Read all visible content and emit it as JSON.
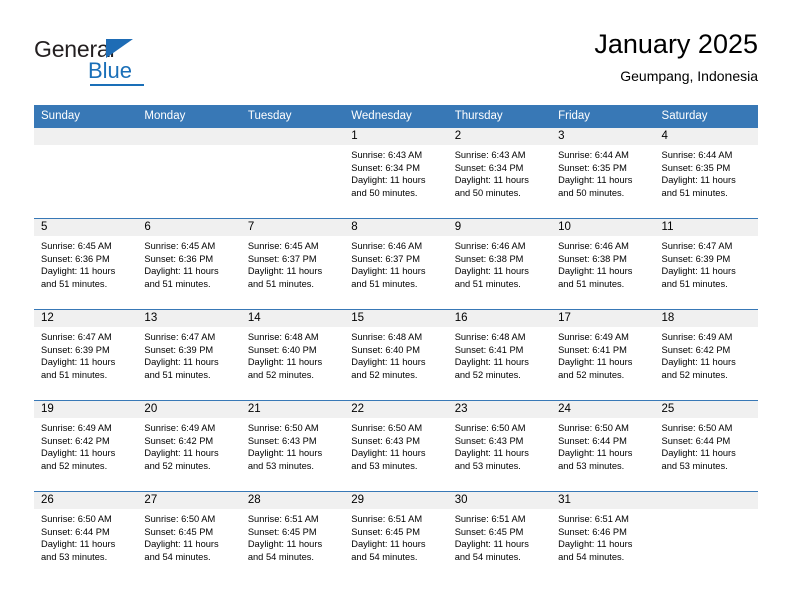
{
  "brand": {
    "name_top": "General",
    "name_bottom": "Blue",
    "accent_color": "#1a6fb8"
  },
  "header": {
    "title": "January 2025",
    "subtitle": "Geumpang, Indonesia"
  },
  "theme": {
    "header_bg": "#3878b6",
    "daynum_bg": "#f0f0f0",
    "text_color": "#000000"
  },
  "weekday_headers": [
    "Sunday",
    "Monday",
    "Tuesday",
    "Wednesday",
    "Thursday",
    "Friday",
    "Saturday"
  ],
  "weeks": [
    [
      {
        "day": "",
        "sunrise": "",
        "sunset": "",
        "daylight1": "",
        "daylight2": ""
      },
      {
        "day": "",
        "sunrise": "",
        "sunset": "",
        "daylight1": "",
        "daylight2": ""
      },
      {
        "day": "",
        "sunrise": "",
        "sunset": "",
        "daylight1": "",
        "daylight2": ""
      },
      {
        "day": "1",
        "sunrise": "Sunrise: 6:43 AM",
        "sunset": "Sunset: 6:34 PM",
        "daylight1": "Daylight: 11 hours",
        "daylight2": "and 50 minutes."
      },
      {
        "day": "2",
        "sunrise": "Sunrise: 6:43 AM",
        "sunset": "Sunset: 6:34 PM",
        "daylight1": "Daylight: 11 hours",
        "daylight2": "and 50 minutes."
      },
      {
        "day": "3",
        "sunrise": "Sunrise: 6:44 AM",
        "sunset": "Sunset: 6:35 PM",
        "daylight1": "Daylight: 11 hours",
        "daylight2": "and 50 minutes."
      },
      {
        "day": "4",
        "sunrise": "Sunrise: 6:44 AM",
        "sunset": "Sunset: 6:35 PM",
        "daylight1": "Daylight: 11 hours",
        "daylight2": "and 51 minutes."
      }
    ],
    [
      {
        "day": "5",
        "sunrise": "Sunrise: 6:45 AM",
        "sunset": "Sunset: 6:36 PM",
        "daylight1": "Daylight: 11 hours",
        "daylight2": "and 51 minutes."
      },
      {
        "day": "6",
        "sunrise": "Sunrise: 6:45 AM",
        "sunset": "Sunset: 6:36 PM",
        "daylight1": "Daylight: 11 hours",
        "daylight2": "and 51 minutes."
      },
      {
        "day": "7",
        "sunrise": "Sunrise: 6:45 AM",
        "sunset": "Sunset: 6:37 PM",
        "daylight1": "Daylight: 11 hours",
        "daylight2": "and 51 minutes."
      },
      {
        "day": "8",
        "sunrise": "Sunrise: 6:46 AM",
        "sunset": "Sunset: 6:37 PM",
        "daylight1": "Daylight: 11 hours",
        "daylight2": "and 51 minutes."
      },
      {
        "day": "9",
        "sunrise": "Sunrise: 6:46 AM",
        "sunset": "Sunset: 6:38 PM",
        "daylight1": "Daylight: 11 hours",
        "daylight2": "and 51 minutes."
      },
      {
        "day": "10",
        "sunrise": "Sunrise: 6:46 AM",
        "sunset": "Sunset: 6:38 PM",
        "daylight1": "Daylight: 11 hours",
        "daylight2": "and 51 minutes."
      },
      {
        "day": "11",
        "sunrise": "Sunrise: 6:47 AM",
        "sunset": "Sunset: 6:39 PM",
        "daylight1": "Daylight: 11 hours",
        "daylight2": "and 51 minutes."
      }
    ],
    [
      {
        "day": "12",
        "sunrise": "Sunrise: 6:47 AM",
        "sunset": "Sunset: 6:39 PM",
        "daylight1": "Daylight: 11 hours",
        "daylight2": "and 51 minutes."
      },
      {
        "day": "13",
        "sunrise": "Sunrise: 6:47 AM",
        "sunset": "Sunset: 6:39 PM",
        "daylight1": "Daylight: 11 hours",
        "daylight2": "and 51 minutes."
      },
      {
        "day": "14",
        "sunrise": "Sunrise: 6:48 AM",
        "sunset": "Sunset: 6:40 PM",
        "daylight1": "Daylight: 11 hours",
        "daylight2": "and 52 minutes."
      },
      {
        "day": "15",
        "sunrise": "Sunrise: 6:48 AM",
        "sunset": "Sunset: 6:40 PM",
        "daylight1": "Daylight: 11 hours",
        "daylight2": "and 52 minutes."
      },
      {
        "day": "16",
        "sunrise": "Sunrise: 6:48 AM",
        "sunset": "Sunset: 6:41 PM",
        "daylight1": "Daylight: 11 hours",
        "daylight2": "and 52 minutes."
      },
      {
        "day": "17",
        "sunrise": "Sunrise: 6:49 AM",
        "sunset": "Sunset: 6:41 PM",
        "daylight1": "Daylight: 11 hours",
        "daylight2": "and 52 minutes."
      },
      {
        "day": "18",
        "sunrise": "Sunrise: 6:49 AM",
        "sunset": "Sunset: 6:42 PM",
        "daylight1": "Daylight: 11 hours",
        "daylight2": "and 52 minutes."
      }
    ],
    [
      {
        "day": "19",
        "sunrise": "Sunrise: 6:49 AM",
        "sunset": "Sunset: 6:42 PM",
        "daylight1": "Daylight: 11 hours",
        "daylight2": "and 52 minutes."
      },
      {
        "day": "20",
        "sunrise": "Sunrise: 6:49 AM",
        "sunset": "Sunset: 6:42 PM",
        "daylight1": "Daylight: 11 hours",
        "daylight2": "and 52 minutes."
      },
      {
        "day": "21",
        "sunrise": "Sunrise: 6:50 AM",
        "sunset": "Sunset: 6:43 PM",
        "daylight1": "Daylight: 11 hours",
        "daylight2": "and 53 minutes."
      },
      {
        "day": "22",
        "sunrise": "Sunrise: 6:50 AM",
        "sunset": "Sunset: 6:43 PM",
        "daylight1": "Daylight: 11 hours",
        "daylight2": "and 53 minutes."
      },
      {
        "day": "23",
        "sunrise": "Sunrise: 6:50 AM",
        "sunset": "Sunset: 6:43 PM",
        "daylight1": "Daylight: 11 hours",
        "daylight2": "and 53 minutes."
      },
      {
        "day": "24",
        "sunrise": "Sunrise: 6:50 AM",
        "sunset": "Sunset: 6:44 PM",
        "daylight1": "Daylight: 11 hours",
        "daylight2": "and 53 minutes."
      },
      {
        "day": "25",
        "sunrise": "Sunrise: 6:50 AM",
        "sunset": "Sunset: 6:44 PM",
        "daylight1": "Daylight: 11 hours",
        "daylight2": "and 53 minutes."
      }
    ],
    [
      {
        "day": "26",
        "sunrise": "Sunrise: 6:50 AM",
        "sunset": "Sunset: 6:44 PM",
        "daylight1": "Daylight: 11 hours",
        "daylight2": "and 53 minutes."
      },
      {
        "day": "27",
        "sunrise": "Sunrise: 6:50 AM",
        "sunset": "Sunset: 6:45 PM",
        "daylight1": "Daylight: 11 hours",
        "daylight2": "and 54 minutes."
      },
      {
        "day": "28",
        "sunrise": "Sunrise: 6:51 AM",
        "sunset": "Sunset: 6:45 PM",
        "daylight1": "Daylight: 11 hours",
        "daylight2": "and 54 minutes."
      },
      {
        "day": "29",
        "sunrise": "Sunrise: 6:51 AM",
        "sunset": "Sunset: 6:45 PM",
        "daylight1": "Daylight: 11 hours",
        "daylight2": "and 54 minutes."
      },
      {
        "day": "30",
        "sunrise": "Sunrise: 6:51 AM",
        "sunset": "Sunset: 6:45 PM",
        "daylight1": "Daylight: 11 hours",
        "daylight2": "and 54 minutes."
      },
      {
        "day": "31",
        "sunrise": "Sunrise: 6:51 AM",
        "sunset": "Sunset: 6:46 PM",
        "daylight1": "Daylight: 11 hours",
        "daylight2": "and 54 minutes."
      },
      {
        "day": "",
        "sunrise": "",
        "sunset": "",
        "daylight1": "",
        "daylight2": ""
      }
    ]
  ]
}
